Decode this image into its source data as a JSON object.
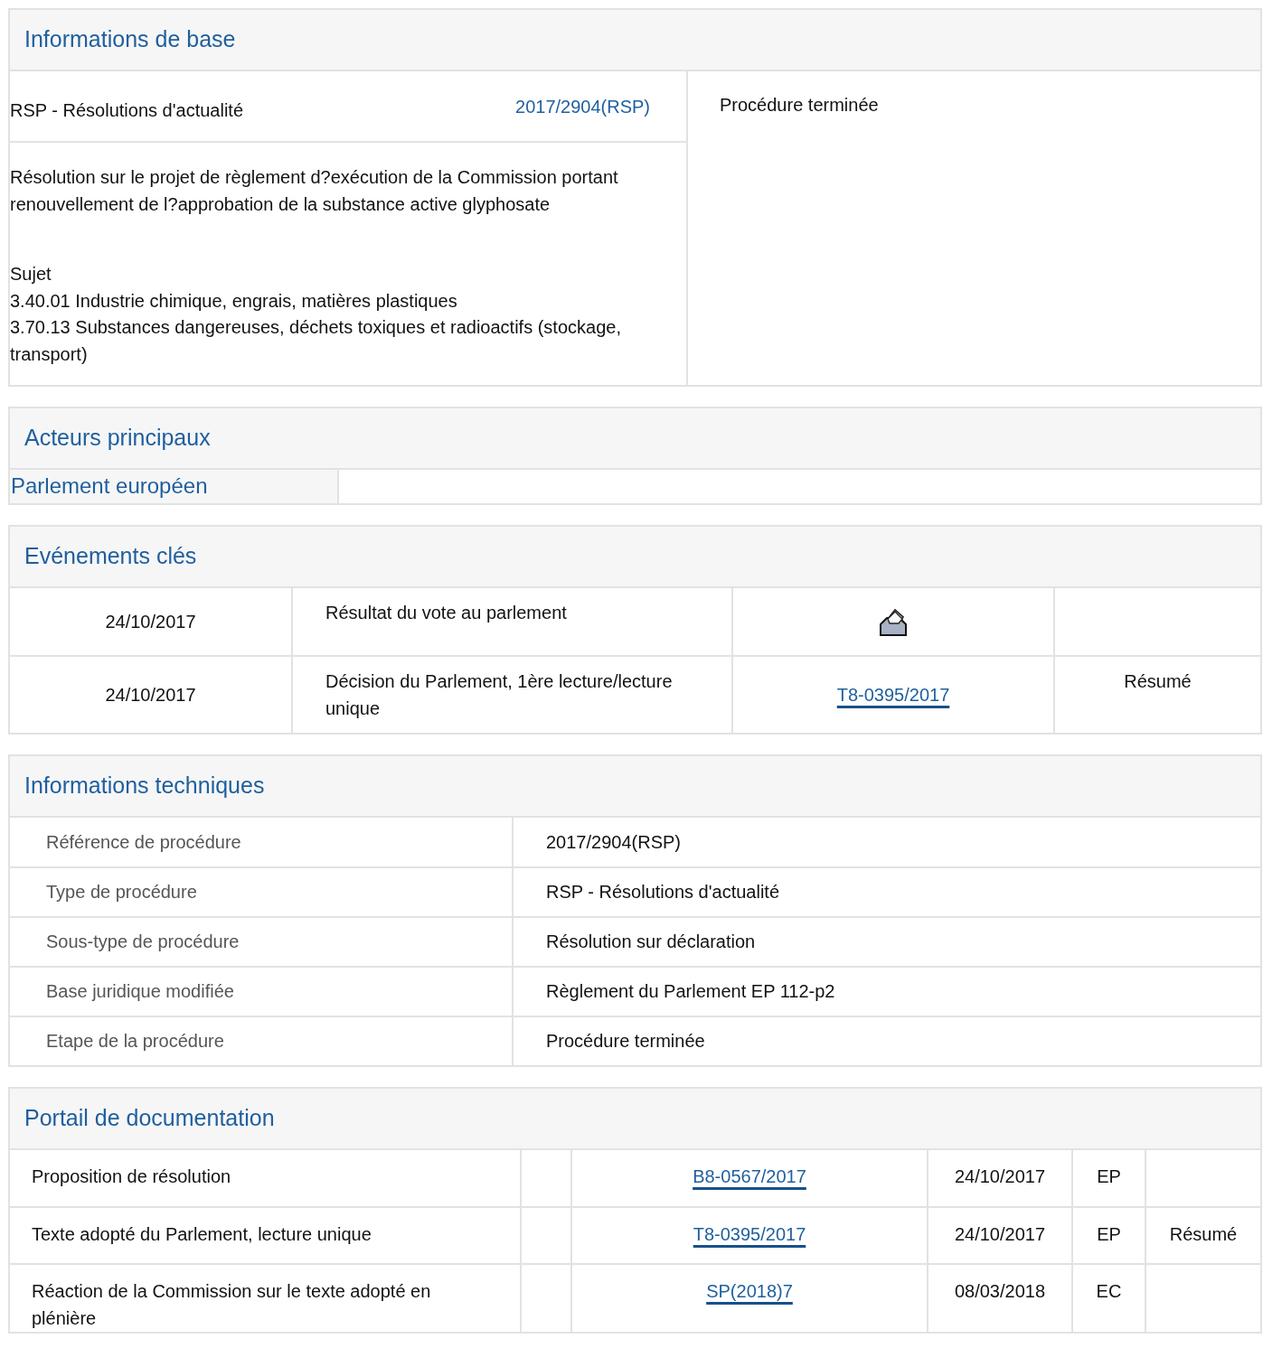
{
  "basic_info": {
    "title": "Informations de base",
    "procedure_type": "RSP - Résolutions d'actualité",
    "reference": "2017/2904(RSP)",
    "status": "Procédure terminée",
    "description": "Résolution sur le projet de règlement d?exécution de la Commission portant renouvellement de l?approbation de la substance active glyphosate",
    "subject_label": "Sujet",
    "subjects": [
      "3.40.01 Industrie chimique, engrais, matières plastiques",
      "3.70.13 Substances dangereuses, déchets toxiques et radioactifs (stockage, transport)"
    ]
  },
  "key_players": {
    "title": "Acteurs principaux",
    "institution": "Parlement européen"
  },
  "key_events": {
    "title": "Evénements clés",
    "rows": [
      {
        "date": "24/10/2017",
        "event": "Résultat du vote au parlement",
        "kind": "vote"
      },
      {
        "date": "24/10/2017",
        "event": "Décision du Parlement, 1ère lecture/lecture unique",
        "kind": "document",
        "document": "T8-0395/2017",
        "summary": "Résumé"
      }
    ]
  },
  "technical_info": {
    "title": "Informations techniques",
    "rows": [
      {
        "label": "Référence de procédure",
        "value": "2017/2904(RSP)"
      },
      {
        "label": "Type de procédure",
        "value": "RSP - Résolutions d'actualité"
      },
      {
        "label": "Sous-type de procédure",
        "value": "Résolution sur déclaration"
      },
      {
        "label": "Base juridique modifiée",
        "value": "Règlement du Parlement EP 112-p2"
      },
      {
        "label": "Etape de la procédure",
        "value": "Procédure terminée"
      }
    ]
  },
  "documentation": {
    "title": "Portail de documentation",
    "rows": [
      {
        "document": "Proposition de résolution",
        "reference": "B8-0567/2017",
        "date": "24/10/2017",
        "source": "EP"
      },
      {
        "document": "Texte adopté du Parlement, lecture unique",
        "reference": "T8-0395/2017",
        "date": "24/10/2017",
        "source": "EP",
        "summary": "Résumé"
      },
      {
        "document": "Réaction de la Commission sur le texte adopté en plénière",
        "reference": "SP(2018)7",
        "date": "08/03/2018",
        "source": "EC"
      }
    ]
  }
}
